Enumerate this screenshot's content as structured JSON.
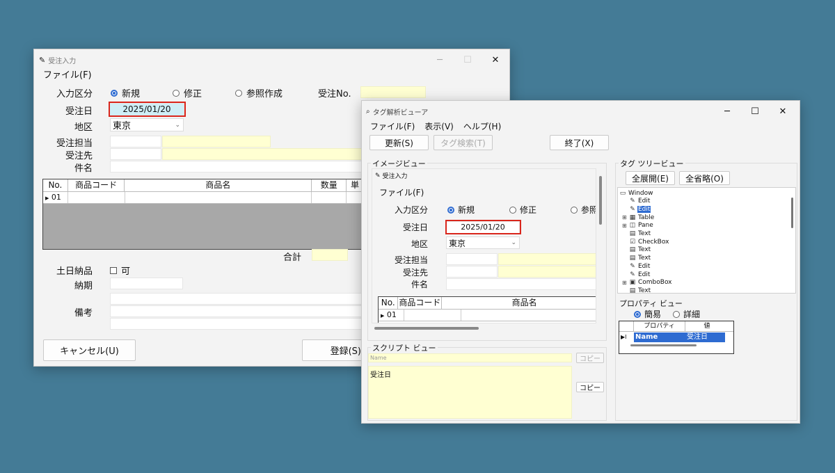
{
  "order_window": {
    "title": "受注入力",
    "menu_file": "ファイル(F)",
    "labels": {
      "input_type": "入力区分",
      "order_date": "受注日",
      "region": "地区",
      "staff": "受注担当",
      "customer": "受注先",
      "subject": "件名",
      "order_no": "受注No.",
      "total": "合計",
      "weekend": "土日納品",
      "deadline": "納期",
      "remarks": "備考"
    },
    "radios": [
      "新規",
      "修正",
      "参照作成"
    ],
    "order_date_value": "2025/01/20",
    "region_value": "東京",
    "weekend_option": "可",
    "grid_headers": [
      "No.",
      "商品コード",
      "商品名",
      "数量",
      "単"
    ],
    "grid_row": [
      "01"
    ],
    "cancel_button": "キャンセル(U)",
    "register_button": "登録(S)"
  },
  "tag_window": {
    "title": "タグ解析ビューア",
    "menus": [
      "ファイル(F)",
      "表示(V)",
      "ヘルプ(H)"
    ],
    "refresh_button": "更新(S)",
    "tag_search_button": "タグ検索(T)",
    "exit_button": "終了(X)",
    "image_view_label": "イメージビュー",
    "script_view_label": "スクリプト ビュー",
    "script_name_placeholder": "Name",
    "script_text": "受注日",
    "copy_button_1": "コピー",
    "copy_button_2": "コピー",
    "tag_tree_label": "タグ ツリービュー",
    "expand_all_button": "全展開(E)",
    "collapse_all_button": "全省略(O)",
    "tree_items": [
      "Window",
      "Edit",
      "Edit",
      "Table",
      "Pane",
      "Text",
      "CheckBox",
      "Text",
      "Text",
      "Edit",
      "Edit",
      "ComboBox",
      "Text"
    ],
    "tree_icons": [
      "window-icon",
      "edit-icon",
      "edit-icon",
      "table-icon",
      "pane-icon",
      "text-icon",
      "checkbox-icon",
      "text-icon",
      "text-icon",
      "edit-icon",
      "edit-icon",
      "combobox-icon",
      "text-icon"
    ],
    "property_view_label": "プロパティ ビュー",
    "prop_radios": [
      "簡易",
      "詳細"
    ],
    "prop_headers": [
      "プロパティ",
      "値"
    ],
    "prop_row_name": "Name",
    "prop_row_value": "受注日",
    "mini": {
      "title": "受注入力",
      "menu_file": "ファイル(F)",
      "input_type": "入力区分",
      "radios": [
        "新規",
        "修正",
        "参照"
      ],
      "order_date": "受注日",
      "order_date_value": "2025/01/20",
      "region": "地区",
      "region_value": "東京",
      "staff": "受注担当",
      "customer": "受注先",
      "subject": "件名",
      "grid_headers": [
        "No.",
        "商品コード",
        "商品名"
      ],
      "grid_row": "01"
    }
  },
  "colors": {
    "highlight_red": "#d9261c",
    "selection_blue": "#2e6bd1",
    "field_yellow": "#ffffd2",
    "desktop": "#447b96"
  }
}
